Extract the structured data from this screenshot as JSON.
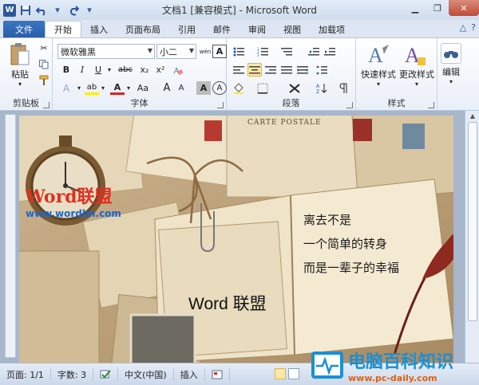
{
  "window": {
    "title": "文档1 [兼容模式] - Microsoft Word"
  },
  "quick_access": {
    "app_icon": "W",
    "save": "save-icon",
    "undo": "undo-icon",
    "redo": "redo-icon"
  },
  "tabs": {
    "file": "文件",
    "items": [
      "开始",
      "插入",
      "页面布局",
      "引用",
      "邮件",
      "审阅",
      "视图",
      "加载项"
    ]
  },
  "clipboard": {
    "paste_label": "粘贴",
    "group_label": "剪贴板"
  },
  "font": {
    "family": "微软雅黑",
    "size": "小二",
    "wen": "wén",
    "group_label": "字体",
    "bold": "B",
    "italic": "I",
    "underline": "U",
    "strike": "abc",
    "sub": "x₂",
    "super": "x²",
    "grow": "A",
    "shrink": "A",
    "aa": "Aa",
    "color_a": "A",
    "highlight": "ab",
    "shade_a": "A",
    "border_a": "A",
    "clear": "A"
  },
  "paragraph": {
    "group_label": "段落"
  },
  "styles": {
    "quick_label": "快速样式",
    "change_label": "更改样式",
    "group_label": "样式"
  },
  "editing": {
    "label": "编辑"
  },
  "document": {
    "poem_lines": [
      "离去不是",
      "一个简单的转身",
      "而是一辈子的幸福"
    ],
    "caption": "Word 联盟",
    "watermark_tl_big": "Word联盟",
    "watermark_tl_small": "www.wordlm.com",
    "watermark_br_big": "电脑百科知识",
    "watermark_br_small": "www.pc-daily.com",
    "postcard_text": "CARTE POSTALE"
  },
  "status": {
    "page": "页面: 1/1",
    "words": "字数: 3",
    "language": "中文(中国)",
    "mode": "插入"
  },
  "colors": {
    "accent": "#2b579a",
    "file_tab": "#2f66b3",
    "selected": "#fde8a6"
  }
}
